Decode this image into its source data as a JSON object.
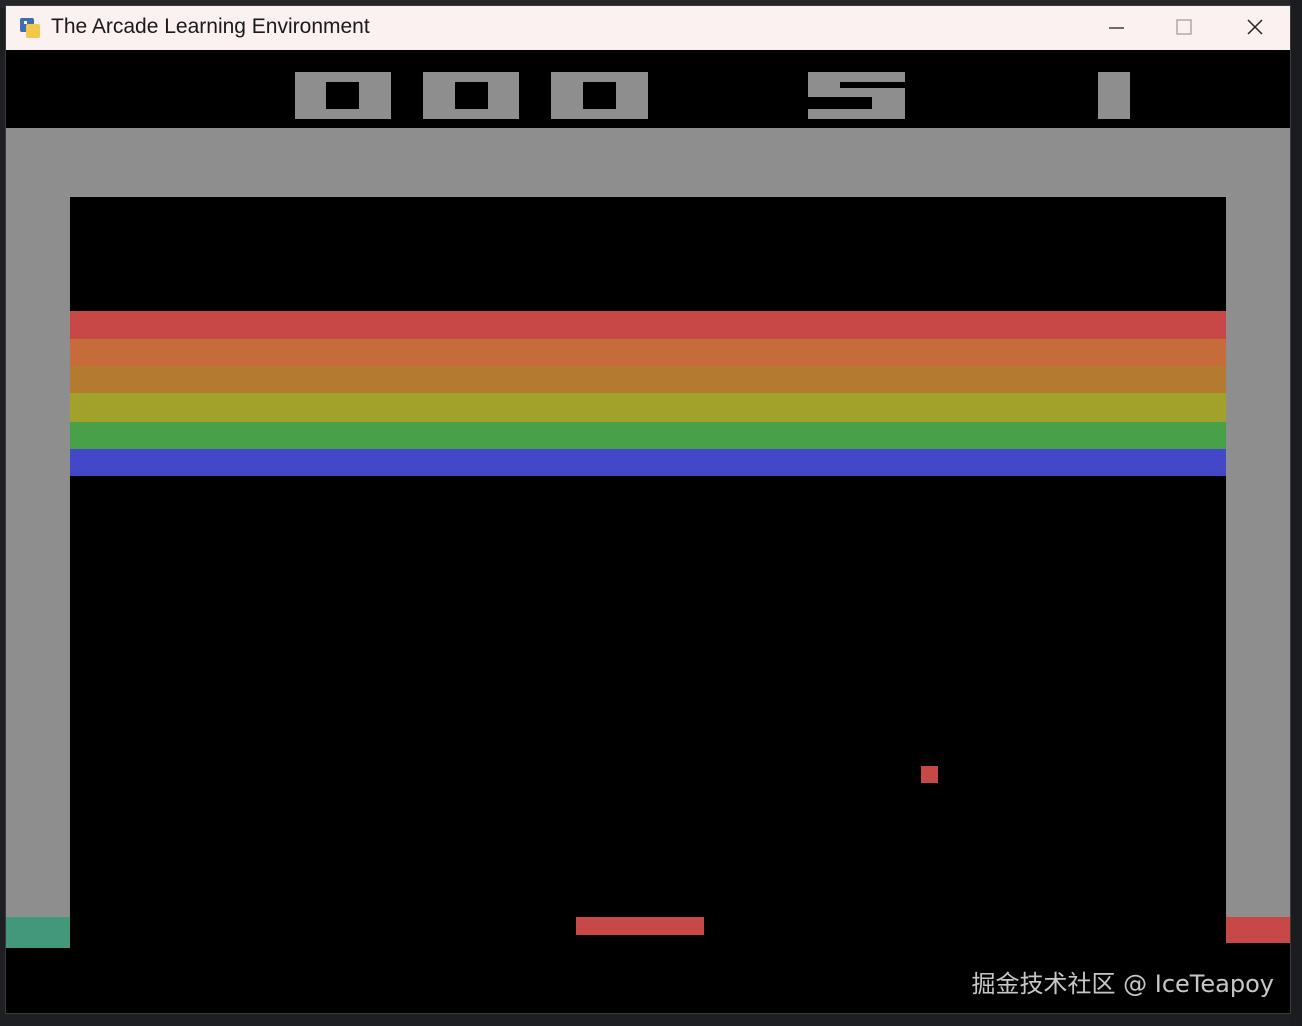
{
  "window": {
    "title": "The Arcade Learning Environment",
    "icon": "python-icon",
    "controls": [
      "minimize-icon",
      "maximize-icon",
      "close-icon"
    ]
  },
  "game": {
    "name": "Breakout",
    "score": "000",
    "lives": "5",
    "player": "1",
    "colors": {
      "wall": "#8e8e8e",
      "background": "#000000",
      "paddle": "#c84848",
      "ball": "#c84848",
      "left_wall_marker": "#42987a",
      "right_wall_marker": "#c84848",
      "brick_rows": [
        "#c84848",
        "#c66c3a",
        "#b47a30",
        "#a2a22a",
        "#48a048",
        "#4248c8"
      ]
    },
    "brick_rows_remaining": 6
  },
  "watermark": "掘金技术社区 @ IceTeapoy"
}
